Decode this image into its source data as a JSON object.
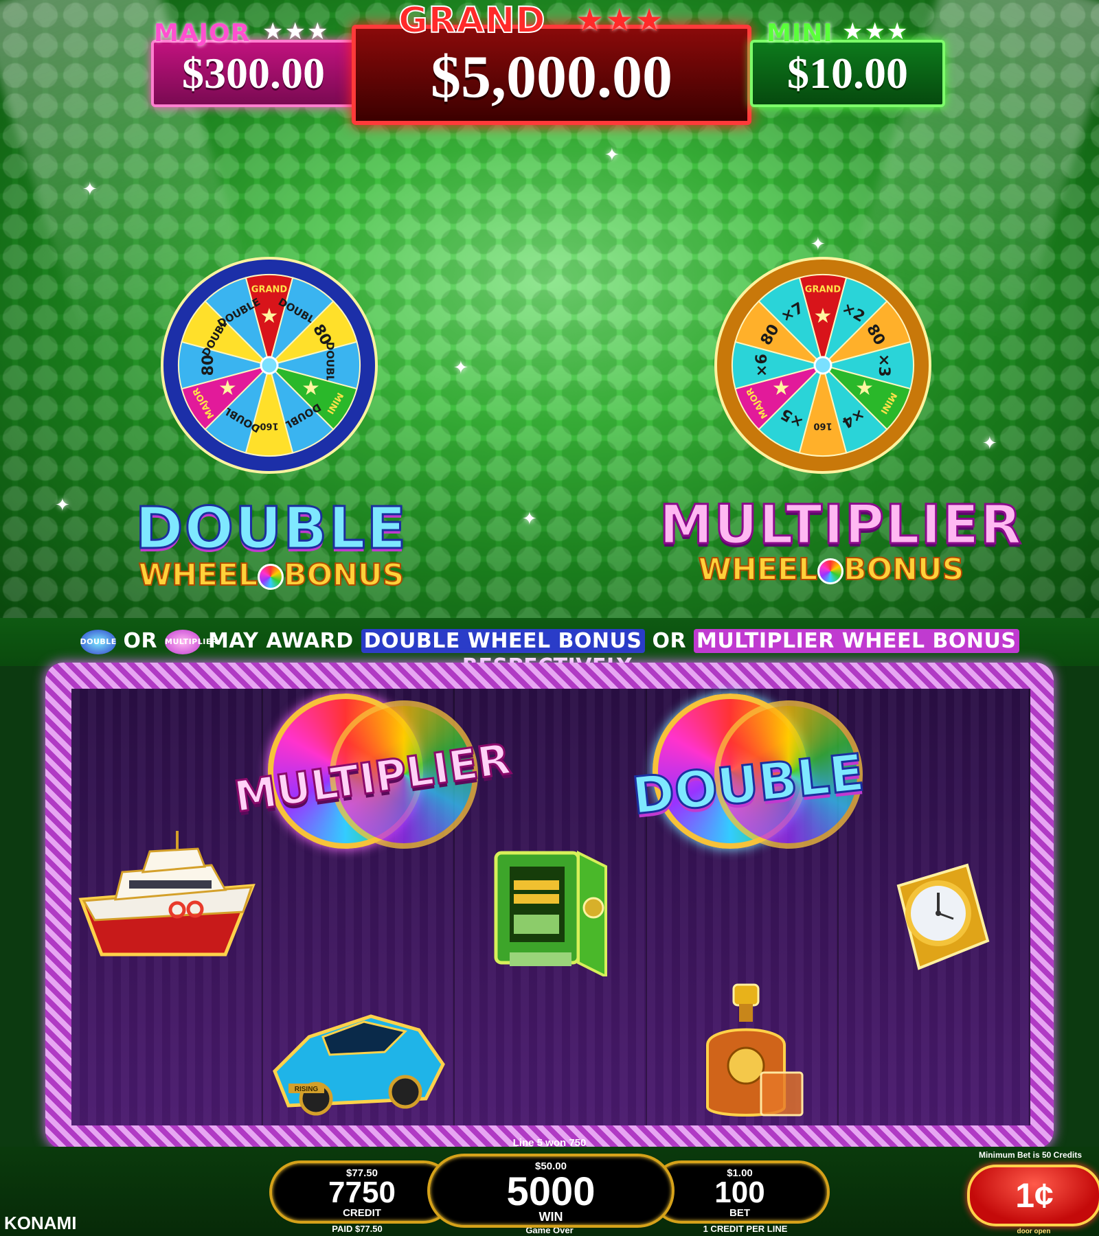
{
  "jackpots": {
    "major": {
      "label": "MAJOR",
      "amount": "$300.00",
      "stars": "★★★"
    },
    "grand": {
      "label": "GRAND",
      "amount": "$5,000.00",
      "stars": "★★★"
    },
    "mini": {
      "label": "MINI",
      "amount": "$10.00",
      "stars": "★★★"
    }
  },
  "double_wheel": {
    "title_big": "DOUBLE",
    "title_small_left": "WHEEL",
    "title_small_right": "BONUS",
    "segments": [
      "GRAND",
      "DOUBLE",
      "80",
      "DOUBLE",
      "MINI",
      "DOUBLE",
      "160",
      "DOUBLE",
      "MAJOR",
      "80",
      "DOUBLE",
      "DOUBLE"
    ]
  },
  "multiplier_wheel": {
    "title_big": "MULTIPLIER",
    "title_small_left": "WHEEL",
    "title_small_right": "BONUS",
    "segments": [
      "GRAND",
      "×2",
      "80",
      "×3",
      "MINI",
      "×4",
      "160",
      "×5",
      "MAJOR",
      "×6",
      "80",
      "×7"
    ]
  },
  "info": {
    "icon1": "DOUBLE",
    "or1": "OR",
    "icon2": "MULTIPLIER",
    "may": "MAY AWARD",
    "double": "DOUBLE WHEEL BONUS",
    "or2": "OR",
    "multiplier": "MULTIPLIER WHEEL BONUS",
    "respectively": "RESPECTIVELY."
  },
  "reels": {
    "multiplier_symbol": "MULTIPLIER",
    "double_symbol": "DOUBLE",
    "car_plate": "RISING"
  },
  "status": {
    "line_win": "Line 5 won 750",
    "min_bet": "Minimum Bet is 50 Credits",
    "credit_dollar": "$77.50",
    "credit": "7750",
    "credit_label": "CREDIT",
    "paid": "PAID $77.50",
    "win_dollar": "$50.00",
    "win": "5000",
    "win_label": "WIN",
    "game_over": "Game Over",
    "bet_dollar": "$1.00",
    "bet": "100",
    "bet_label": "BET",
    "per_line": "1 CREDIT PER LINE",
    "denom": "1¢",
    "door_open": "door open",
    "brand": "KONAMI"
  },
  "colors": {
    "background_green": "#2aa52e",
    "reel_purple": "#3a1560",
    "frame_pink": "#c03ad0",
    "grand_red": "#ff2a2a",
    "major_pink": "#ff2aa8",
    "mini_green": "#3aff2a",
    "pill_gold": "#d6a21a"
  }
}
